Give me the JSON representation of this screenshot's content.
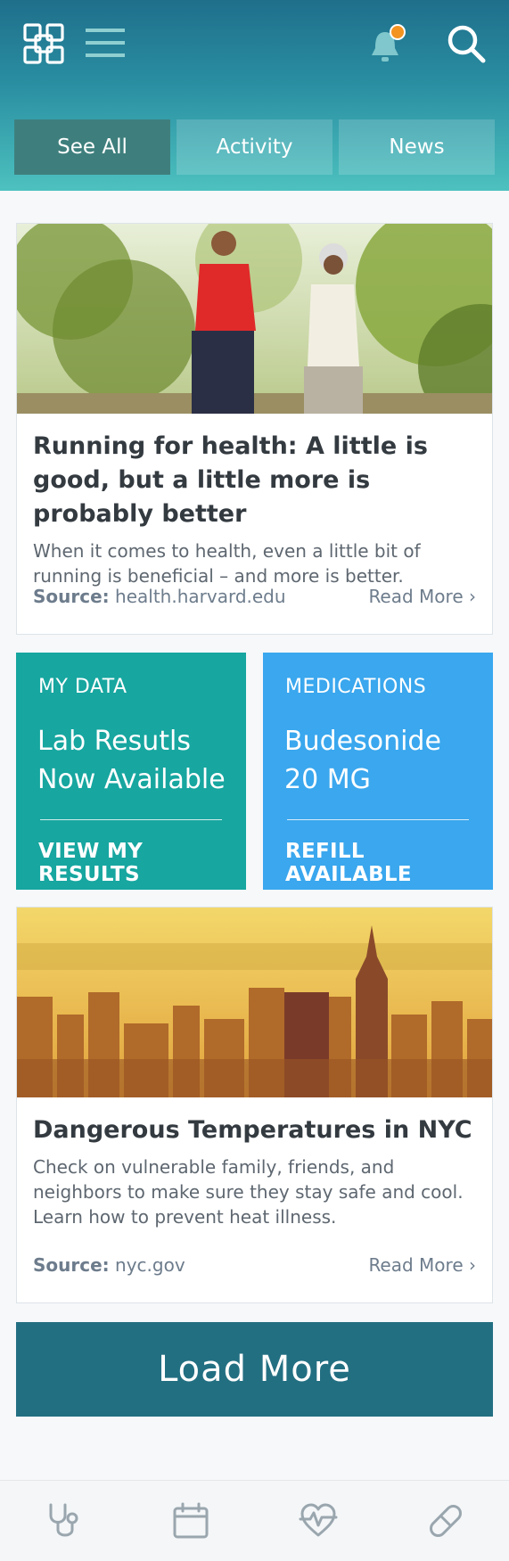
{
  "tabs": [
    {
      "label": "See All"
    },
    {
      "label": "Activity"
    },
    {
      "label": "News"
    }
  ],
  "cards": [
    {
      "title": "Running for health: A little is good, but a little more is probably better",
      "text": "When it comes to health, even a little bit of running is beneficial – and more is better.",
      "source_label": "Source:",
      "source": "health.harvard.edu",
      "read_more": "Read More"
    },
    {
      "title": "Dangerous Temperatures in NYC",
      "text": "Check on vulnerable family, friends, and neighbors to make sure they stay safe and cool. Learn how to prevent heat illness.",
      "source_label": "Source:",
      "source": "nyc.gov",
      "read_more": "Read More"
    }
  ],
  "tiles": {
    "mydata": {
      "category": "MY DATA",
      "main_line1": "Lab Resutls",
      "main_line2": "Now Available",
      "cta": "VIEW MY RESULTS",
      "color": "#17a6a0"
    },
    "medications": {
      "category": "MEDICATIONS",
      "main_line1": "Budesonide",
      "main_line2": "20 MG",
      "cta": "REFILL AVAILABLE",
      "color": "#3aa7ee"
    }
  },
  "load_more": "Load More",
  "colors": {
    "notification_dot": "#f39320",
    "header_top": "#1f6f8b",
    "header_bottom": "#4dc1bf"
  },
  "icons": [
    "app-logo-icon",
    "menu-icon",
    "bell-icon",
    "search-icon",
    "stethoscope-icon",
    "calendar-icon",
    "heart-pulse-icon",
    "pill-icon"
  ]
}
